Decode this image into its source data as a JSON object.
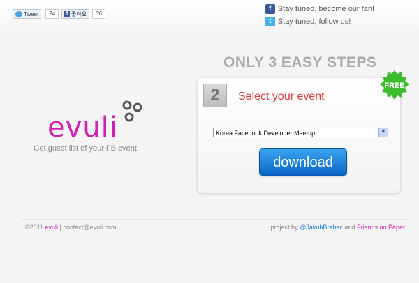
{
  "share": {
    "tweet_label": "Tweet",
    "tweet_count": "24",
    "like_label": "좋아요",
    "like_count": "36"
  },
  "social": {
    "facebook_text": "Stay tuned, become our fan!",
    "twitter_text": "Stay tuned, follow us!"
  },
  "brand": {
    "logo_text": "evuli",
    "tagline": "Get guest list of your FB event."
  },
  "steps": {
    "title": "ONLY 3 EASY STEPS",
    "number": "2",
    "label": "Select your event",
    "badge": "FREE",
    "select_value": "Korea Facebook Developer Meetup",
    "download_label": "download"
  },
  "footer": {
    "copyright_prefix": "©2011",
    "brand": "evuli",
    "separator": "|",
    "contact": "contact@evuli.com",
    "project_prefix": "project by",
    "author": "@JakubBrabec",
    "and": "and",
    "partner": "Friends on Paper"
  },
  "colors": {
    "brand_pink": "#d41fb6",
    "step_red": "#e0373a",
    "button_blue": "#0a66c6",
    "badge_green": "#3dbb2e"
  }
}
